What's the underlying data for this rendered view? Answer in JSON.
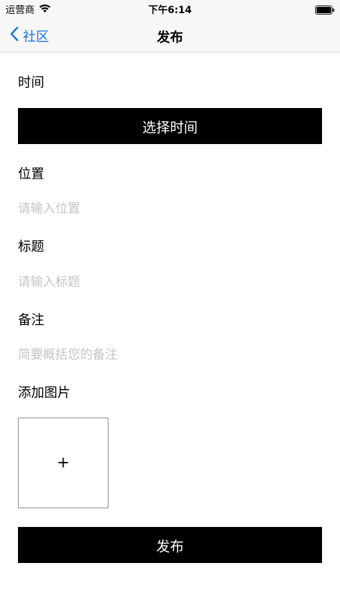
{
  "status_bar": {
    "carrier": "运营商",
    "time": "下午6:14"
  },
  "nav": {
    "back_label": "社区",
    "title": "发布"
  },
  "form": {
    "time_label": "时间",
    "select_time_button": "选择时间",
    "location_label": "位置",
    "location_placeholder": "请输入位置",
    "title_label": "标题",
    "title_placeholder": "请输入标题",
    "note_label": "备注",
    "note_placeholder": "简要概括您的备注",
    "add_image_label": "添加图片",
    "add_image_symbol": "+",
    "publish_button": "发布"
  },
  "icons": {
    "wifi": "wifi-icon",
    "battery": "battery-icon",
    "back": "chevron-left-icon"
  },
  "colors": {
    "accent": "#1a73e8",
    "button_bg": "#000000",
    "placeholder": "#c4c4c8"
  }
}
